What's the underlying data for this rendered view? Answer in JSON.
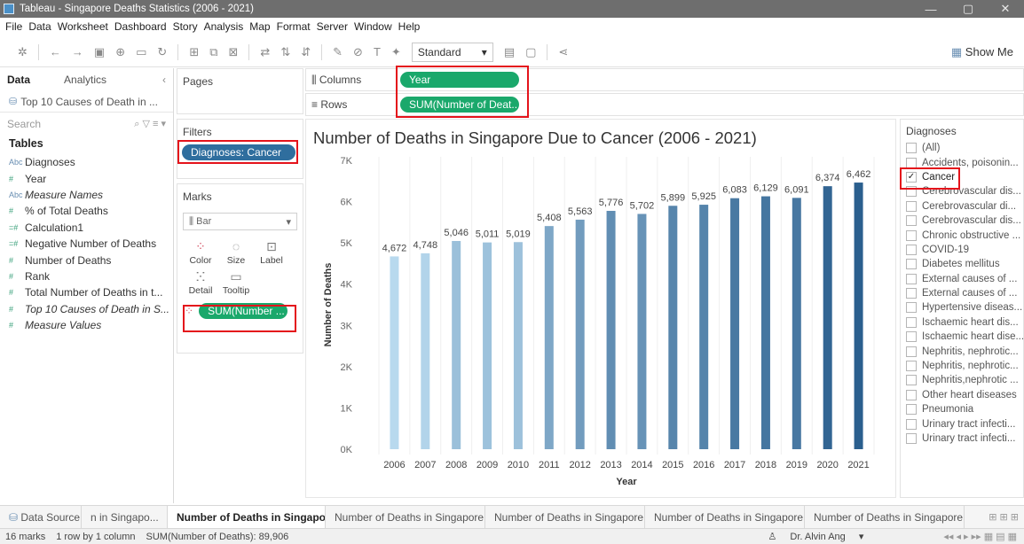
{
  "window": {
    "title": "Tableau - Singapore Deaths Statistics (2006 - 2021)",
    "minimize": "—",
    "restore": "▢",
    "close": "✕"
  },
  "menu": [
    "File",
    "Data",
    "Worksheet",
    "Dashboard",
    "Story",
    "Analysis",
    "Map",
    "Format",
    "Server",
    "Window",
    "Help"
  ],
  "toolbar": {
    "fit": "Standard",
    "show_me": "Show Me"
  },
  "left": {
    "tab_data": "Data",
    "tab_analytics": "Analytics",
    "datasource": "Top 10 Causes of Death in ...",
    "search_placeholder": "Search",
    "tables_heading": "Tables",
    "fields": [
      {
        "label": "Diagnoses",
        "icon": "Abc"
      },
      {
        "label": "Year",
        "icon": "#"
      },
      {
        "label": "Measure Names",
        "icon": "Abc"
      },
      {
        "label": "% of Total Deaths",
        "icon": "#"
      },
      {
        "label": "Calculation1",
        "icon": "=#"
      },
      {
        "label": "Negative Number of Deaths",
        "icon": "=#"
      },
      {
        "label": "Number of Deaths",
        "icon": "#"
      },
      {
        "label": "Rank",
        "icon": "#"
      },
      {
        "label": "Total Number of Deaths in t...",
        "icon": "#"
      },
      {
        "label": "Top 10 Causes of Death in S...",
        "icon": "#"
      },
      {
        "label": "Measure Values",
        "icon": "#"
      }
    ]
  },
  "pages": {
    "label": "Pages"
  },
  "filters": {
    "label": "Filters",
    "pill": "Diagnoses: Cancer"
  },
  "marks": {
    "label": "Marks",
    "type": "Bar",
    "buttons": [
      "Color",
      "Size",
      "Label",
      "Detail",
      "Tooltip"
    ],
    "pill": "SUM(Number ..."
  },
  "shelves": {
    "columns_label": "Columns",
    "columns_pill": "Year",
    "rows_label": "Rows",
    "rows_pill": "SUM(Number of Deat.."
  },
  "chart_data": {
    "type": "bar",
    "title": "Number of Deaths in Singapore Due to Cancer (2006 - 2021)",
    "xlabel": "Year",
    "ylabel": "Number of Deaths",
    "categories": [
      "2006",
      "2007",
      "2008",
      "2009",
      "2010",
      "2011",
      "2012",
      "2013",
      "2014",
      "2015",
      "2016",
      "2017",
      "2018",
      "2019",
      "2020",
      "2021"
    ],
    "values": [
      4672,
      4748,
      5046,
      5011,
      5019,
      5408,
      5563,
      5776,
      5702,
      5899,
      5925,
      6083,
      6129,
      6091,
      6374,
      6462
    ],
    "data_labels": [
      "4,672",
      "4,748",
      "5,046",
      "5,011",
      "5,019",
      "5,408",
      "5,563",
      "5,776",
      "5,702",
      "5,899",
      "5,925",
      "6,083",
      "6,129",
      "6,091",
      "6,374",
      "6,462"
    ],
    "yticks": [
      "0K",
      "1K",
      "2K",
      "3K",
      "4K",
      "5K",
      "6K",
      "7K"
    ],
    "ylim": [
      0,
      7000
    ],
    "grid": "vertical",
    "color_low": "#b8d9ee",
    "color_high": "#2b5f8e"
  },
  "quick_filter": {
    "title": "Diagnoses",
    "items": [
      {
        "label": "(All)",
        "checked": false
      },
      {
        "label": "Accidents, poisonin...",
        "checked": false
      },
      {
        "label": "Cancer",
        "checked": true
      },
      {
        "label": "Cerebrovascular dis...",
        "checked": false
      },
      {
        "label": "Cerebrovascular  di...",
        "checked": false
      },
      {
        "label": "Cerebrovascular dis...",
        "checked": false
      },
      {
        "label": "Chronic obstructive ...",
        "checked": false
      },
      {
        "label": "COVID-19",
        "checked": false
      },
      {
        "label": "Diabetes mellitus",
        "checked": false
      },
      {
        "label": "External causes of ...",
        "checked": false
      },
      {
        "label": "External causes  of ...",
        "checked": false
      },
      {
        "label": "Hypertensive diseas...",
        "checked": false
      },
      {
        "label": "Ischaemic heart dis...",
        "checked": false
      },
      {
        "label": "Ischaemic heart dise...",
        "checked": false
      },
      {
        "label": "Nephritis, nephrotic...",
        "checked": false
      },
      {
        "label": "Nephritis, nephrotic...",
        "checked": false
      },
      {
        "label": "Nephritis,nephrotic ...",
        "checked": false
      },
      {
        "label": "Other heart diseases",
        "checked": false
      },
      {
        "label": "Pneumonia",
        "checked": false
      },
      {
        "label": "Urinary tract infecti...",
        "checked": false
      },
      {
        "label": "Urinary tract infecti...",
        "checked": false
      }
    ]
  },
  "sheet_tabs": {
    "data_source": "Data Source",
    "tabs": [
      {
        "label": "n in Singapo...",
        "active": false
      },
      {
        "label": "Number of Deaths in Singapor...",
        "active": true
      },
      {
        "label": "Number of Deaths in Singapore ...",
        "active": false
      },
      {
        "label": "Number of Deaths in Singapore ...",
        "active": false
      },
      {
        "label": "Number of Deaths in Singapore ...",
        "active": false
      },
      {
        "label": "Number of Deaths in Singapore ...",
        "active": false
      }
    ]
  },
  "status": {
    "marks": "16 marks",
    "rows_cols": "1 row by 1 column",
    "sum": "SUM(Number of Deaths): 89,906",
    "user": "Dr. Alvin Ang"
  }
}
